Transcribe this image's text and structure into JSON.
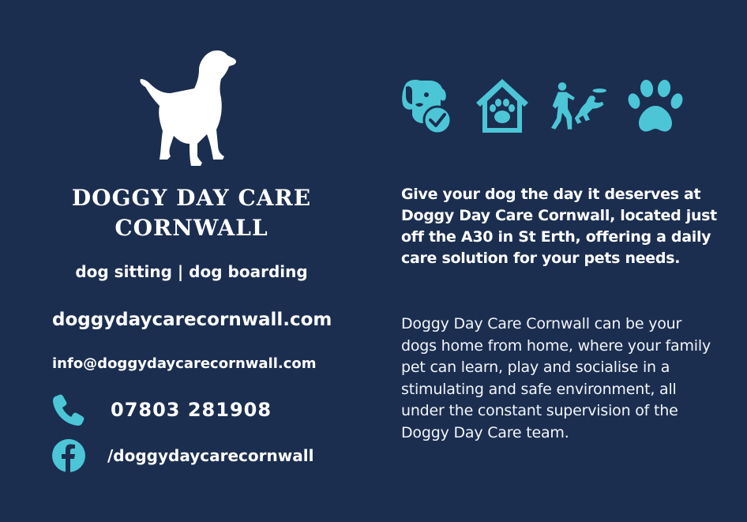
{
  "brand": {
    "title_line1": "DOGGY DAY CARE",
    "title_line2": "CORNWALL",
    "services": "dog sitting | dog boarding"
  },
  "contact": {
    "website": "doggydaycarecornwall.com",
    "email": "info@doggydaycarecornwall.com",
    "phone": "07803 281908",
    "facebook": "/doggydaycarecornwall"
  },
  "icons": {
    "logo": "dog-silhouette-icon",
    "phone": "phone-icon",
    "facebook": "facebook-icon",
    "features": [
      "dog-check-icon",
      "paw-house-icon",
      "person-frisbee-dog-icon",
      "paw-print-icon"
    ]
  },
  "colors": {
    "background": "#1b2e50",
    "accent": "#4cc6d6",
    "text": "#ffffff"
  },
  "copy": {
    "intro": "Give your dog the day it deserves at Doggy Day Care Cornwall, located just off the A30 in St Erth, offering a daily care solution for your pets needs.",
    "about": "Doggy Day Care Cornwall can be your dogs home from home, where your family pet can learn, play and socialise in a stimulating and safe environment, all under the constant supervision of the Doggy Day Care team."
  }
}
